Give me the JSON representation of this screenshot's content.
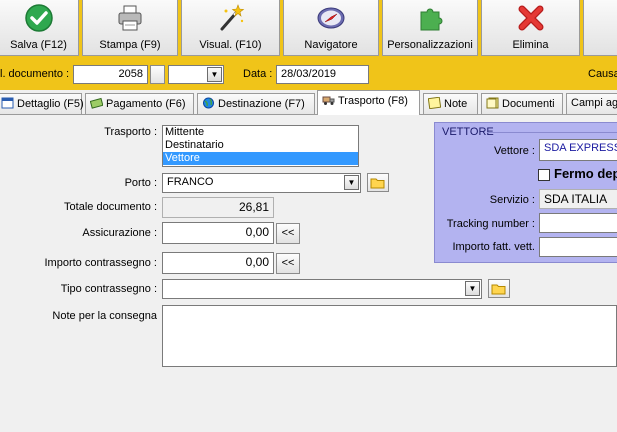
{
  "toolbar": {
    "buttons": [
      {
        "label": "Salva (F12)",
        "icon": "checkmark-icon"
      },
      {
        "label": "Stampa (F9)",
        "icon": "printer-icon"
      },
      {
        "label": "Visual. (F10)",
        "icon": "magic-wand-icon"
      },
      {
        "label": "Navigatore",
        "icon": "compass-icon"
      },
      {
        "label": "Personalizzazioni",
        "icon": "puzzle-icon"
      },
      {
        "label": "Elimina",
        "icon": "delete-x-icon"
      }
    ]
  },
  "header": {
    "doc_number_label": "l. documento :",
    "doc_number": "2058",
    "data_label": "Data :",
    "data_value": "28/03/2019",
    "causale_label": "Causa"
  },
  "tabs": [
    {
      "label": "Dettaglio (F5)",
      "icon": "detail-icon"
    },
    {
      "label": "Pagamento (F6)",
      "icon": "money-icon"
    },
    {
      "label": "Destinazione (F7)",
      "icon": "globe-icon"
    },
    {
      "label": "Trasporto (F8)",
      "icon": "truck-icon",
      "active": true
    },
    {
      "label": "Note",
      "icon": "note-icon"
    },
    {
      "label": "Documenti",
      "icon": "documents-icon"
    },
    {
      "label": "Campi agg",
      "icon": ""
    }
  ],
  "form": {
    "trasporto_label": "Trasporto :",
    "trasporto_options": [
      "Mittente",
      "Destinatario",
      "Vettore"
    ],
    "trasporto_selected": "Vettore",
    "porto_label": "Porto :",
    "porto_value": "FRANCO",
    "totale_label": "Totale documento :",
    "totale_value": "26,81",
    "assicurazione_label": "Assicurazione :",
    "assicurazione_value": "0,00",
    "contrassegno_label": "Importo contrassegno :",
    "contrassegno_value": "0,00",
    "copy_label": "<<",
    "tipo_label": "Tipo contrassegno :",
    "tipo_value": "",
    "note_label": "Note per la consegna",
    "note_value": ""
  },
  "vettore": {
    "legend": "VETTORE",
    "vettore_label": "Vettore :",
    "vettore_value": "SDA EXPRESS C",
    "fermo_label": "Fermo dep",
    "servizio_label": "Servizio :",
    "servizio_value": "SDA ITALIA",
    "tracking_label": "Tracking number :",
    "tracking_value": "",
    "importo_label": "Importo fatt. vett.",
    "importo_value": ""
  },
  "colors": {
    "toolbar_bg": "#f0c419",
    "vettore_panel": "#b3b3f0",
    "selection": "#3399ff"
  }
}
